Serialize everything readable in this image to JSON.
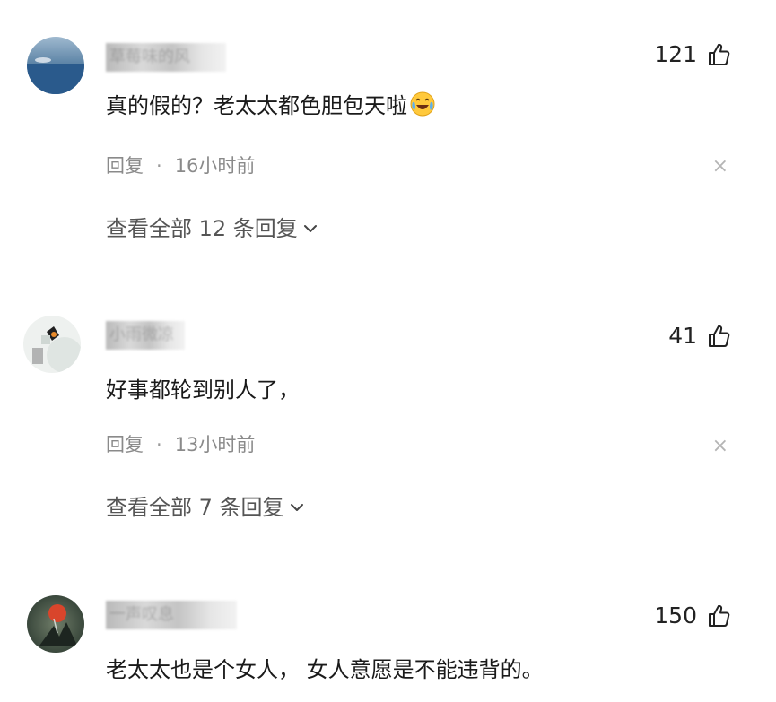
{
  "comments": [
    {
      "username": "草莓味的风",
      "likes": "121",
      "text": "真的假的？老太太都色胆包天啦",
      "emoji": "crying-laughing-emoji",
      "reply_label": "回复",
      "separator": "·",
      "time": "16小时前",
      "close": "×",
      "view_replies": "查看全部 12 条回复"
    },
    {
      "username": "小雨微凉",
      "likes": "41",
      "text": "好事都轮到别人了，",
      "reply_label": "回复",
      "separator": "·",
      "time": "13小时前",
      "close": "×",
      "view_replies": "查看全部 7 条回复"
    },
    {
      "username": "一声叹息",
      "likes": "150",
      "text": "老太太也是个女人，  女人意愿是不能违背的。"
    }
  ],
  "icons": {
    "like": "thumbs-up-outline-icon",
    "expand": "chevron-down-icon"
  },
  "colors": {
    "text_primary": "#1a1a1a",
    "text_secondary": "#8a8a8a",
    "link": "#555555"
  }
}
